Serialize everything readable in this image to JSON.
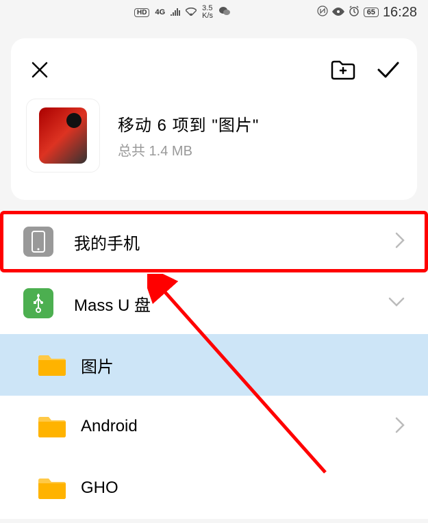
{
  "status_bar": {
    "hd": "HD",
    "network": "4G",
    "speed_top": "3.5",
    "speed_bottom": "K/s",
    "battery": "65",
    "time": "16:28"
  },
  "header": {
    "move_title": "移动 6 项到 \"图片\"",
    "move_subtitle": "总共 1.4 MB"
  },
  "storage_list": [
    {
      "label": "我的手机",
      "icon": "phone",
      "chevron": "right",
      "highlighted": true
    },
    {
      "label": "Mass U 盘",
      "icon": "usb",
      "chevron": "down",
      "highlighted": false
    }
  ],
  "folder_list": [
    {
      "label": "图片",
      "selected": true,
      "chevron": null
    },
    {
      "label": "Android",
      "selected": false,
      "chevron": "right"
    },
    {
      "label": "GHO",
      "selected": false,
      "chevron": null
    }
  ]
}
